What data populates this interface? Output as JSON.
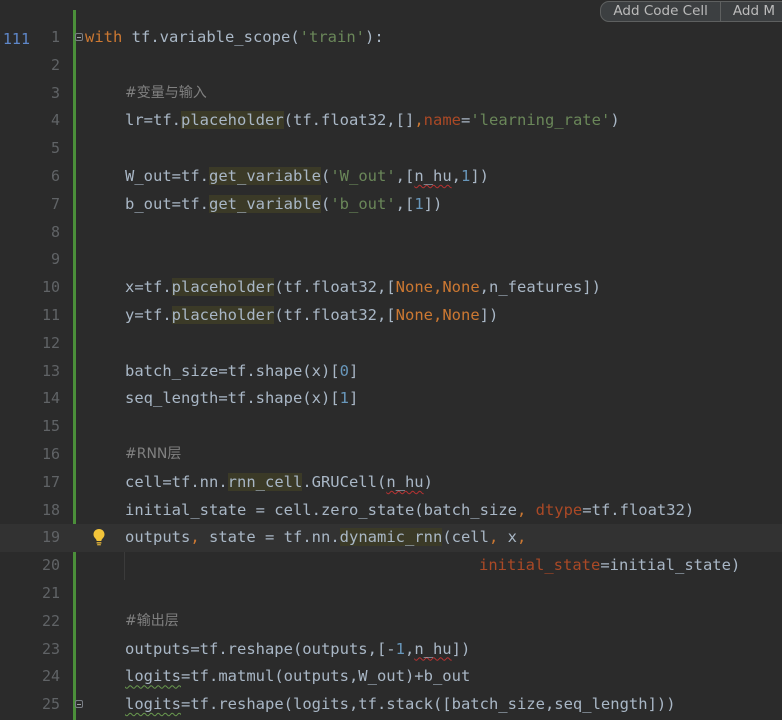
{
  "toolbar": {
    "add_code_cell": "Add Code Cell",
    "add_markdown_cell": "Add M"
  },
  "cell": {
    "execution_count": "111"
  },
  "line_numbers": [
    "1",
    "2",
    "3",
    "4",
    "5",
    "6",
    "7",
    "8",
    "9",
    "10",
    "11",
    "12",
    "13",
    "14",
    "15",
    "16",
    "17",
    "18",
    "19",
    "20",
    "21",
    "22",
    "23",
    "24",
    "25"
  ],
  "code": {
    "l1": {
      "with": "with",
      "a": " tf.",
      "fn": "variable_scope",
      "b": "(",
      "s": "'train'",
      "c": "):"
    },
    "l3": {
      "comment": "#变量与输入"
    },
    "l4": {
      "a": "lr=tf.",
      "fn": "placeholder",
      "b": "(tf.float32,[]",
      "comma": ",",
      "kw": "name",
      "eq": "=",
      "s": "'learning_rate'",
      "c": ")"
    },
    "l6": {
      "a": "W_out=tf.",
      "fn": "get_variable",
      "b": "(",
      "s": "'W_out'",
      "c": ",[",
      "w": "n_hu",
      "d": ",",
      "n": "1",
      "e": "])"
    },
    "l7": {
      "a": "b_out=tf.",
      "fn": "get_variable",
      "b": "(",
      "s": "'b_out'",
      "c": ",[",
      "n": "1",
      "e": "])"
    },
    "l10": {
      "a": "x=tf.",
      "fn": "placeholder",
      "b": "(tf.float32,[",
      "n1": "None",
      "c1": ",",
      "n2": "None",
      "c2": ",n_features])"
    },
    "l11": {
      "a": "y=tf.",
      "fn": "placeholder",
      "b": "(tf.float32,[",
      "n1": "None",
      "c1": ",",
      "n2": "None",
      "c2": "])"
    },
    "l13": {
      "a": "batch_size=tf.shape(x)[",
      "n": "0",
      "b": "]"
    },
    "l14": {
      "a": "seq_length=tf.shape(x)[",
      "n": "1",
      "b": "]"
    },
    "l16": {
      "comment": "#RNN层"
    },
    "l17": {
      "a": "cell=tf.nn.",
      "hl": "rnn_cell",
      "b": ".GRUCell(",
      "w": "n_hu",
      "c": ")"
    },
    "l18": {
      "a": "initial_state = cell.zero_state(batch_size",
      "comma": ", ",
      "kw": "dtype",
      "b": "=tf.float32)"
    },
    "l19": {
      "a": "outputs",
      "comma": ", ",
      "b": "state = tf.nn.",
      "fn": "dynamic_rnn",
      "c": "(cell",
      "comma2": ", ",
      "d": "x",
      "comma3": ","
    },
    "l20": {
      "kw": "initial_state",
      "a": "=initial_state)"
    },
    "l22": {
      "comment": "#输出层"
    },
    "l23": {
      "a": "outputs=tf.reshape(outputs,[-",
      "n": "1",
      "b": ",",
      "w": "n_hu",
      "c": "])"
    },
    "l24": {
      "w": "logits",
      "a": "=tf.matmul(outputs,W_out)+b_out"
    },
    "l25": {
      "w": "logits",
      "a": "=tf.reshape(logits,tf.stack([batch_size,seq_length]))"
    }
  }
}
